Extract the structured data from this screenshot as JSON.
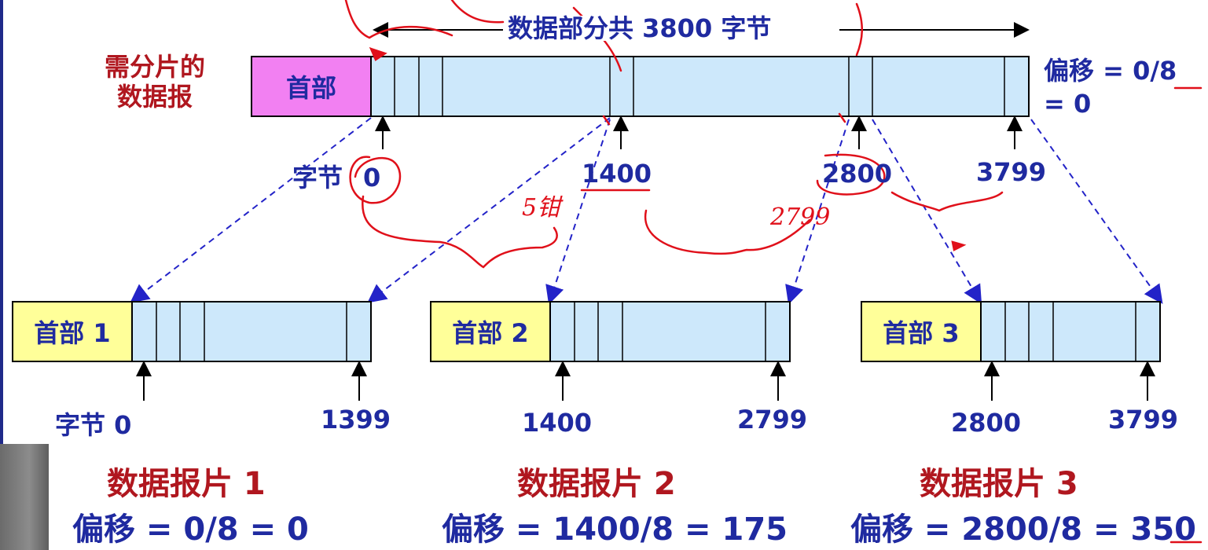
{
  "header": {
    "total_label": "数据部分共 3800 字节"
  },
  "original": {
    "caption": "需分片的\n数据报",
    "header_label": "首部",
    "offset_line1": "偏移 = 0/8",
    "offset_line2": "= 0",
    "byte_prefix": "字节",
    "byte_0": "0",
    "byte_1400": "1400",
    "byte_2800": "2800",
    "byte_3799": "3799"
  },
  "fragments": [
    {
      "header_label": "首部 1",
      "start_label": "字节 0",
      "end_label": "1399",
      "title": "数据报片 1",
      "offset": "偏移 = 0/8 = 0"
    },
    {
      "header_label": "首部 2",
      "start_label": "1400",
      "end_label": "2799",
      "title": "数据报片 2",
      "offset": "偏移 = 1400/8 = 175"
    },
    {
      "header_label": "首部 3",
      "start_label": "2800",
      "end_label": "3799",
      "title": "数据报片 3",
      "offset": "偏移 = 2800/8 = 350"
    }
  ],
  "annotations": {
    "handwritten_1": "5钳",
    "handwritten_2": "2799"
  },
  "colors": {
    "header_original": "#f280f2",
    "header_fragment": "#ffff99",
    "data_fill": "#cde8fb",
    "text_blue": "#1f2aa0",
    "text_darkred": "#b0171f",
    "dashed_line": "#2323c8",
    "ink_red": "#e0101a"
  }
}
